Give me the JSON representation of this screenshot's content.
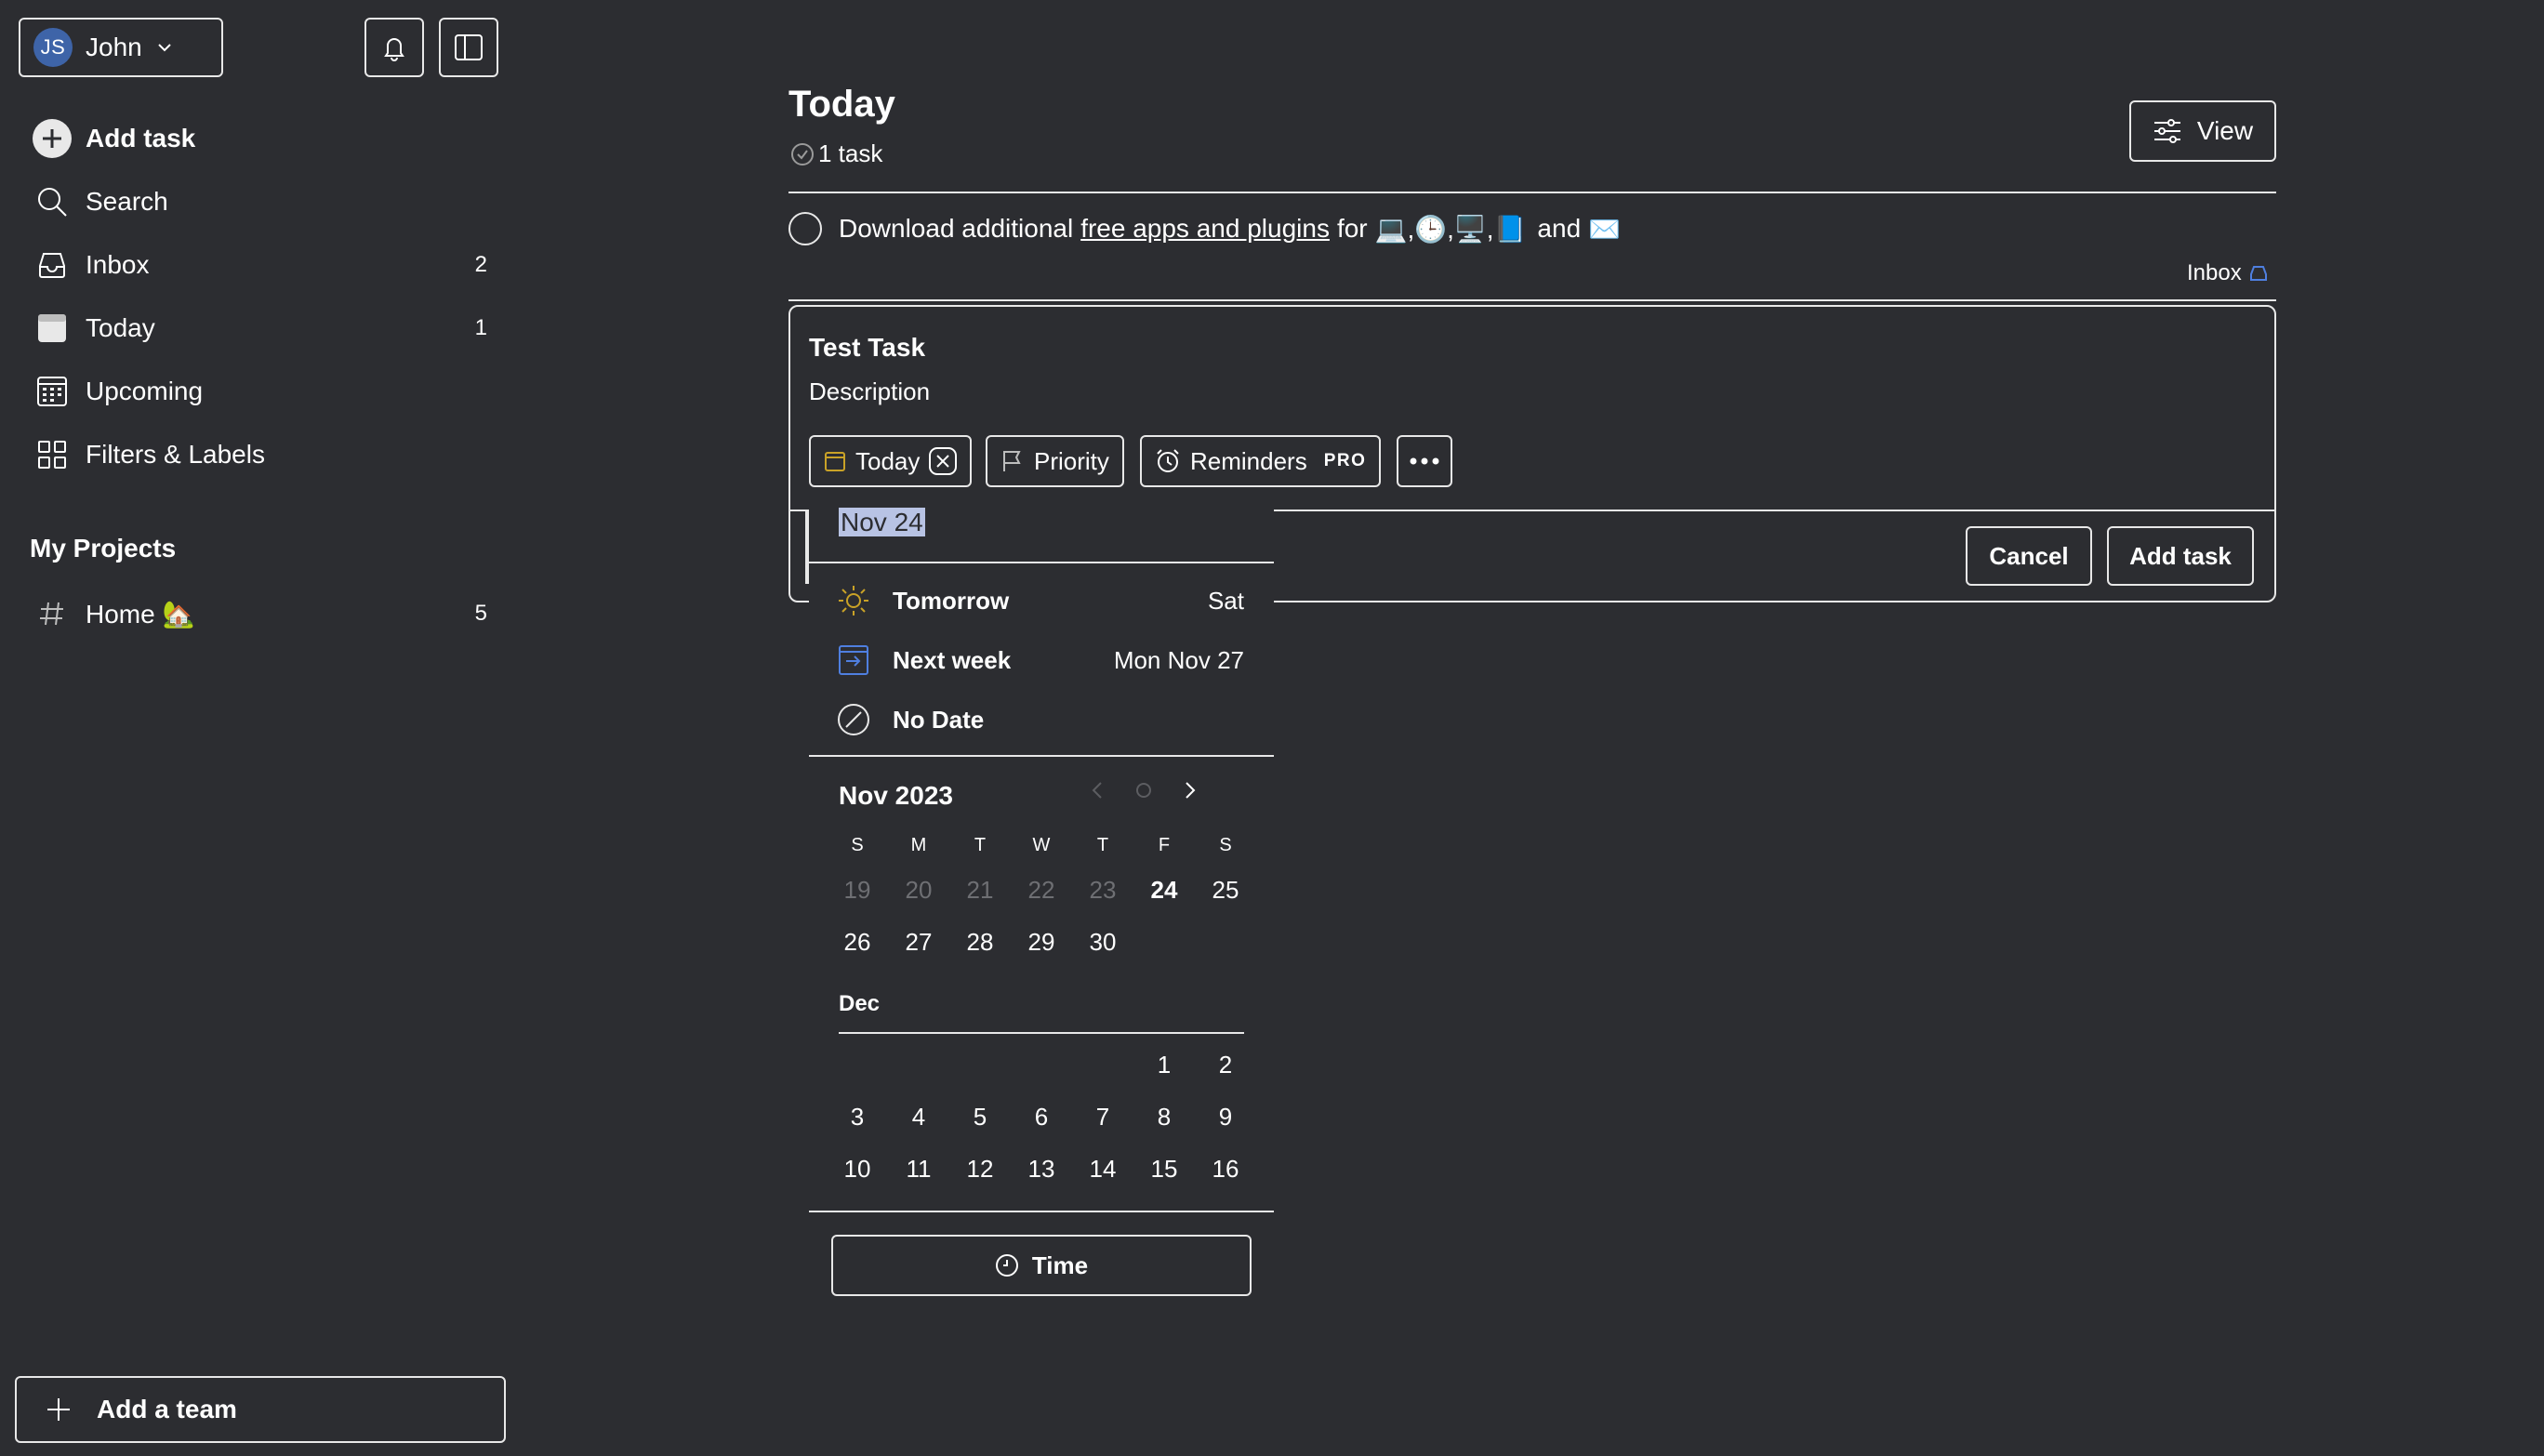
{
  "sidebar": {
    "user": {
      "initials": "JS",
      "name": "John"
    },
    "nav": [
      {
        "label": "Add task",
        "count": ""
      },
      {
        "label": "Search",
        "count": ""
      },
      {
        "label": "Inbox",
        "count": "2"
      },
      {
        "label": "Today",
        "count": "1"
      },
      {
        "label": "Upcoming",
        "count": ""
      },
      {
        "label": "Filters & Labels",
        "count": ""
      }
    ],
    "projects_title": "My Projects",
    "projects": [
      {
        "label": "Home 🏡",
        "count": "5"
      }
    ],
    "add_team": "Add a team"
  },
  "main": {
    "title": "Today",
    "subtitle": "1 task",
    "view_label": "View",
    "task": {
      "text_before": "Download additional",
      "link": "free apps and plugins",
      "text_mid": "for",
      "emojis": "💻,🕒,🖥️,📘",
      "text_and": "and",
      "emoji_last": "✉️",
      "project": "Inbox"
    },
    "editor": {
      "title": "Test Task",
      "description": "Description",
      "chip_date": "Today",
      "chip_priority": "Priority",
      "chip_reminders": "Reminders",
      "pro_badge": "PRO",
      "cancel": "Cancel",
      "add": "Add task"
    }
  },
  "datepicker": {
    "input_value": "Nov 24",
    "options": [
      {
        "label": "Tomorrow",
        "date": "Sat"
      },
      {
        "label": "Next week",
        "date": "Mon Nov 27"
      },
      {
        "label": "No Date",
        "date": ""
      }
    ],
    "month": "Nov 2023",
    "weekdays": [
      "S",
      "M",
      "T",
      "W",
      "T",
      "F",
      "S"
    ],
    "nov_rows": [
      [
        "19",
        "20",
        "21",
        "22",
        "23",
        "24",
        "25"
      ],
      [
        "26",
        "27",
        "28",
        "29",
        "30",
        "",
        ""
      ]
    ],
    "dec_label": "Dec",
    "dec_rows": [
      [
        "",
        "",
        "",
        "",
        "",
        "1",
        "2"
      ],
      [
        "3",
        "4",
        "5",
        "6",
        "7",
        "8",
        "9"
      ],
      [
        "10",
        "11",
        "12",
        "13",
        "14",
        "15",
        "16"
      ]
    ],
    "time_label": "Time"
  },
  "colors": {
    "background": "#2c2d31",
    "border": "#e8e8e8",
    "avatar": "#3e64a8",
    "selection": "#b8c3e4",
    "today_icon": "#c9a227",
    "nextweek_icon": "#4f7fe0"
  }
}
